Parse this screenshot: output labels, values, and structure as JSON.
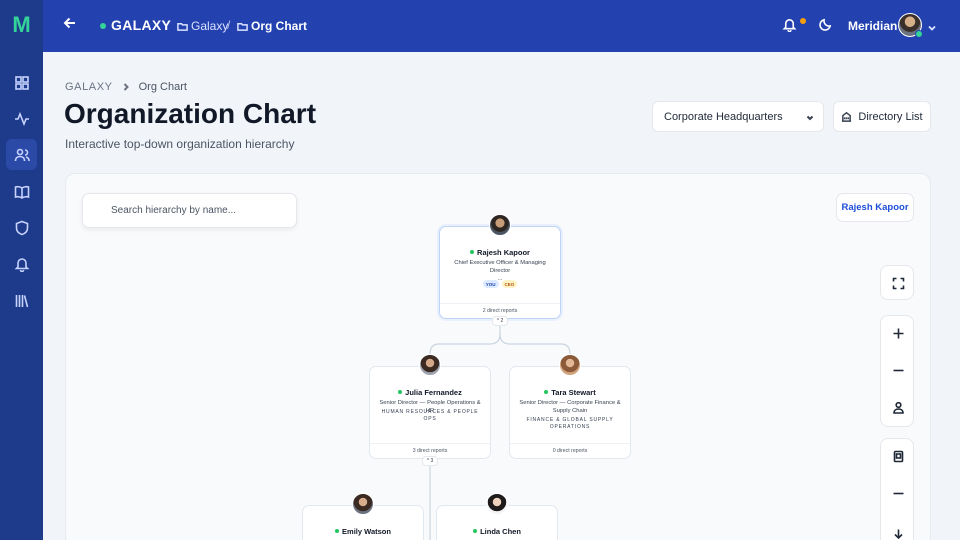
{
  "app": {
    "logo": "M",
    "brand": "GALAXY",
    "accent": "#2342b0",
    "status_color": "#34d399"
  },
  "topbar": {
    "crumbs": [
      {
        "label": "Galaxy"
      },
      {
        "label": "Org Chart"
      }
    ],
    "separator": "/",
    "user_name": "Meridian"
  },
  "sidebar": {
    "items": [
      {
        "icon": "dashboard-icon"
      },
      {
        "icon": "activity-icon"
      },
      {
        "icon": "users-icon",
        "active": true
      },
      {
        "icon": "book-icon"
      },
      {
        "icon": "shield-icon"
      },
      {
        "icon": "bell-icon"
      },
      {
        "icon": "library-icon"
      }
    ]
  },
  "page": {
    "breadcrumb_root": "GALAXY",
    "breadcrumb_current": "Org Chart",
    "title": "Organization Chart",
    "subtitle": "Interactive top-down organization hierarchy",
    "location_select": "Corporate Headquarters",
    "directory_button": "Directory List"
  },
  "canvas": {
    "search_placeholder": "Search hierarchy by name...",
    "focus_person": "Rajesh Kapoor",
    "nodes": {
      "root": {
        "name": "Rajesh Kapoor",
        "role": "Chief Executive Officer & Managing Director",
        "role_ellipsis": "...",
        "badges": [
          "YOU",
          "CEO"
        ],
        "reports": "2 direct reports",
        "toggle": "^ 2"
      },
      "julia": {
        "name": "Julia Fernandez",
        "role": "Senior Director — People Operations & HR",
        "dept": "HUMAN RESOURCES & PEOPLE OPS",
        "reports": "3 direct reports",
        "toggle": "^ 3"
      },
      "tara": {
        "name": "Tara Stewart",
        "role": "Senior Director — Corporate Finance & Supply Chain",
        "dept": "FINANCE & GLOBAL SUPPLY OPERATIONS",
        "reports": "0 direct reports"
      },
      "emily": {
        "name": "Emily Watson"
      },
      "linda": {
        "name": "Linda Chen"
      }
    }
  }
}
